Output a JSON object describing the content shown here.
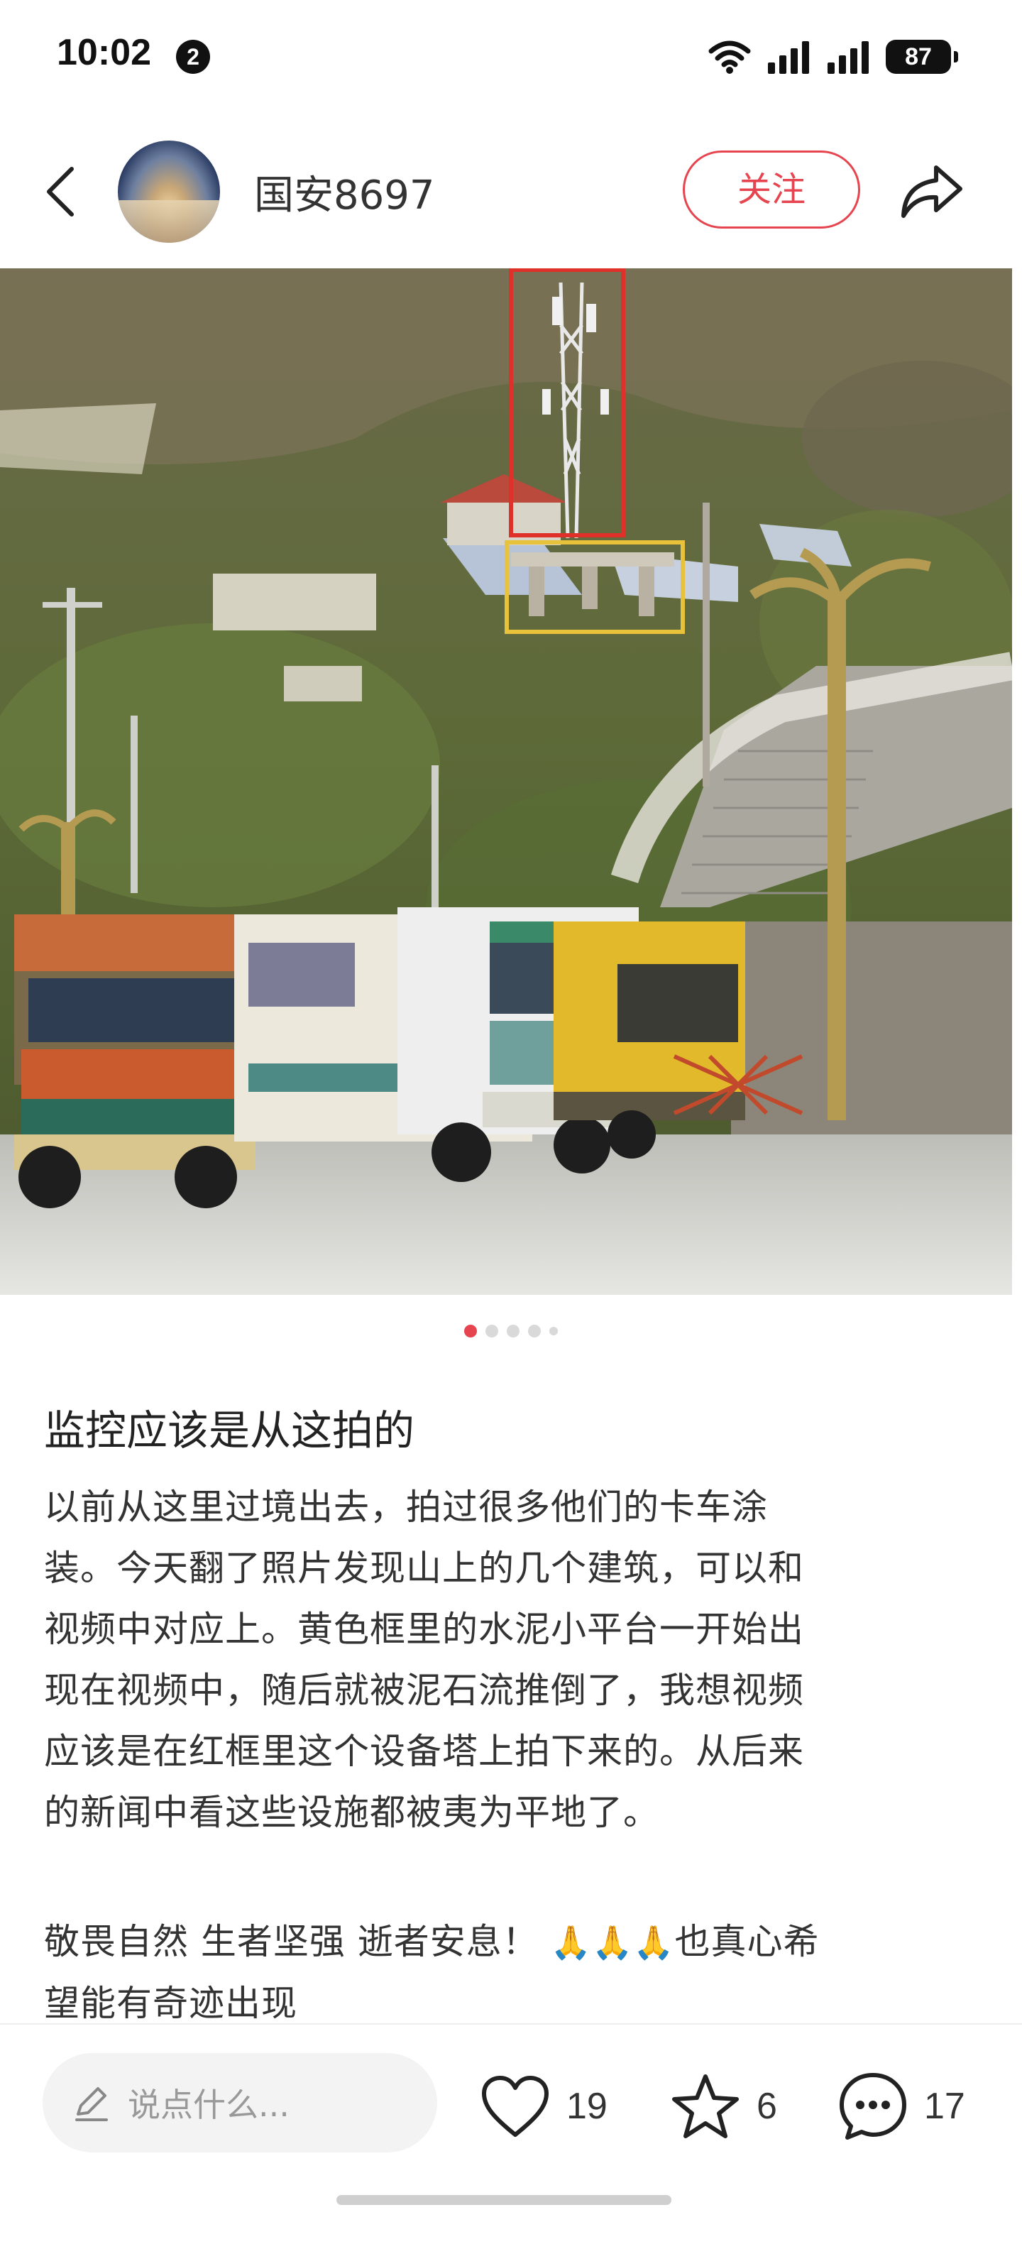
{
  "status_bar": {
    "time": "10:02",
    "notification_count": "2",
    "battery": "87"
  },
  "header": {
    "username": "国安8697",
    "follow_label": "关注"
  },
  "photo": {
    "page_count": 5,
    "current_page": 1,
    "highlight_colors": {
      "red_box": "#e0302a",
      "yellow_box": "#e8c23a"
    }
  },
  "post": {
    "title": "监控应该是从这拍的",
    "body_lines": [
      "以前从这里过境出去，拍过很多他们的卡车涂",
      "装。今天翻了照片发现山上的几个建筑，可以和",
      "视频中对应上。黄色框里的水泥小平台一开始出",
      "现在视频中，随后就被泥石流推倒了，我想视频",
      "应该是在红框里这个设备塔上拍下来的。从后来",
      "的新闻中看这些设施都被夷为平地了。"
    ],
    "closing_line1": "敬畏自然 生者坚强 逝者安息！",
    "closing_emoji": "🙏🙏🙏",
    "closing_line1_end": "也真心希",
    "closing_line2": "望能有奇迹出现"
  },
  "bottom_bar": {
    "comment_placeholder": "说点什么...",
    "likes": "19",
    "favorites": "6",
    "comments": "17"
  },
  "colors": {
    "accent": "#e6454f"
  }
}
